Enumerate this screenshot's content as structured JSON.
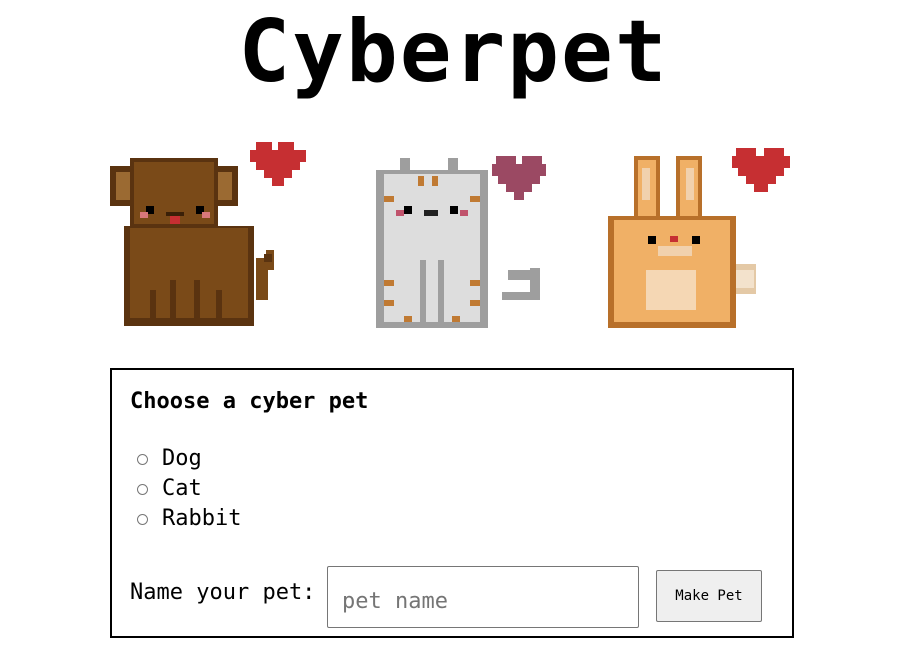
{
  "title": "Cyberpet",
  "pets": [
    {
      "kind": "Dog",
      "icon": "dog-icon",
      "heart_color": "#c62f32",
      "fur": "#7a4a18"
    },
    {
      "kind": "Cat",
      "icon": "cat-icon",
      "heart_color": "#9b4963",
      "fur": "#dddddd"
    },
    {
      "kind": "Rabbit",
      "icon": "rabbit-icon",
      "heart_color": "#c62f32",
      "fur": "#f0b066"
    }
  ],
  "form": {
    "heading": "Choose a cyber pet",
    "options": [
      {
        "label": "Dog",
        "checked": false
      },
      {
        "label": "Cat",
        "checked": false
      },
      {
        "label": "Rabbit",
        "checked": false
      }
    ],
    "name_label": "Name your pet:",
    "name_placeholder": "pet name",
    "name_value": "",
    "submit_label": "Make Pet"
  }
}
